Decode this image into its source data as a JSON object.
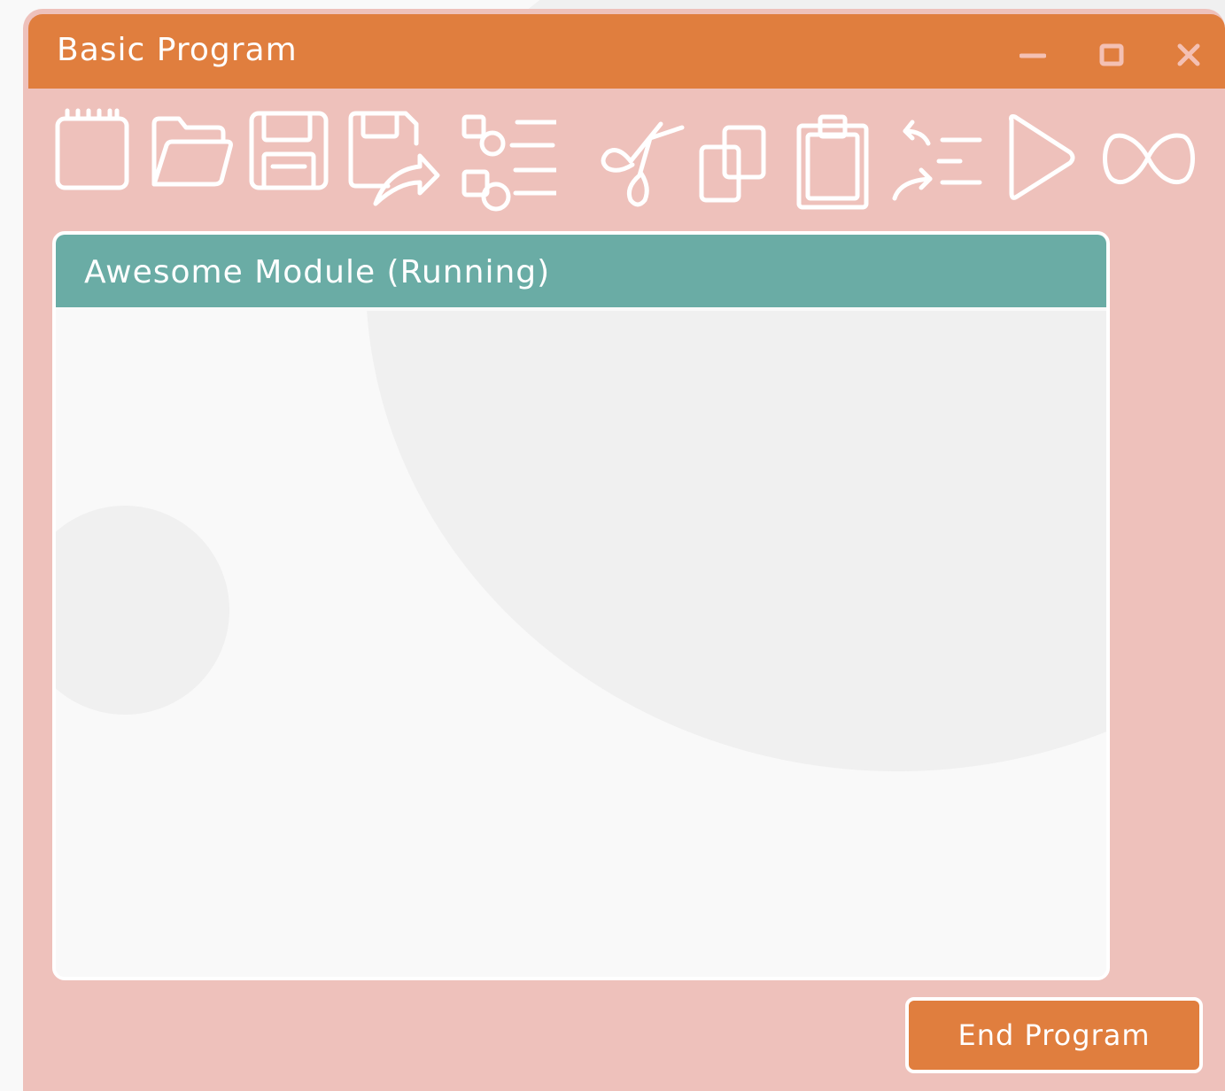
{
  "window": {
    "title": "Basic Program",
    "controls": [
      "minimize-icon",
      "maximize-icon",
      "close-icon"
    ]
  },
  "toolbar": {
    "icons": [
      "notepad-new-icon",
      "open-folder-icon",
      "save-floppy-icon",
      "save-as-icon",
      "list-shapes-icon",
      "scissors-cut-icon",
      "copy-icon",
      "paste-clipboard-icon",
      "undo-redo-list-icon",
      "play-icon",
      "infinity-loop-icon"
    ]
  },
  "module": {
    "title": "Awesome Module (Running)"
  },
  "actions": {
    "end_label": "End Program"
  },
  "colors": {
    "title_bar": "#e07e3e",
    "window_body": "#eec1bb",
    "module_header": "#6aaca5",
    "panel_bg": "#f9f9f9",
    "icon_stroke": "#ffffff"
  }
}
